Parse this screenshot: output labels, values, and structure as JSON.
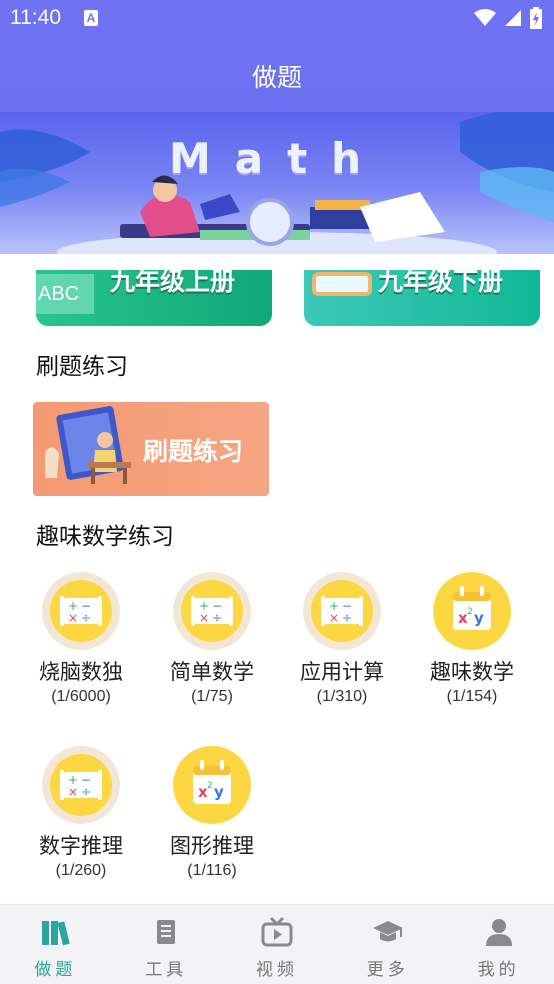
{
  "status_bar": {
    "time": "11:40",
    "notification_icon": "A"
  },
  "header": {
    "title": "做题"
  },
  "banner": {
    "text": "Math"
  },
  "grade_cards": [
    {
      "label": "九年级上册",
      "chip": "ABC"
    },
    {
      "label": "九年级下册"
    }
  ],
  "sections": {
    "practice": {
      "title": "刷题练习",
      "card_label": "刷题练习"
    },
    "fun_math": {
      "title": "趣味数学练习"
    }
  },
  "fun_items": [
    {
      "name": "烧脑数独",
      "count": "(1/6000)",
      "icon": "math-symbols-icon"
    },
    {
      "name": "简单数学",
      "count": "(1/75)",
      "icon": "math-symbols-icon"
    },
    {
      "name": "应用计算",
      "count": "(1/310)",
      "icon": "math-symbols-icon"
    },
    {
      "name": "趣味数学",
      "count": "(1/154)",
      "icon": "calendar-formula-icon"
    },
    {
      "name": "数字推理",
      "count": "(1/260)",
      "icon": "math-symbols-icon"
    },
    {
      "name": "图形推理",
      "count": "(1/116)",
      "icon": "calendar-formula-icon"
    }
  ],
  "bottom_nav": [
    {
      "label": "做题",
      "icon": "books-icon",
      "active": true
    },
    {
      "label": "工具",
      "icon": "document-icon",
      "active": false
    },
    {
      "label": "视频",
      "icon": "tv-play-icon",
      "active": false
    },
    {
      "label": "更多",
      "icon": "graduation-cap-icon",
      "active": false
    },
    {
      "label": "我的",
      "icon": "person-icon",
      "active": false
    }
  ],
  "colors": {
    "header": "#6f73f3",
    "accent": "#2aa6a0",
    "yellow": "#fcd742",
    "practice_card": "#f49a72"
  }
}
